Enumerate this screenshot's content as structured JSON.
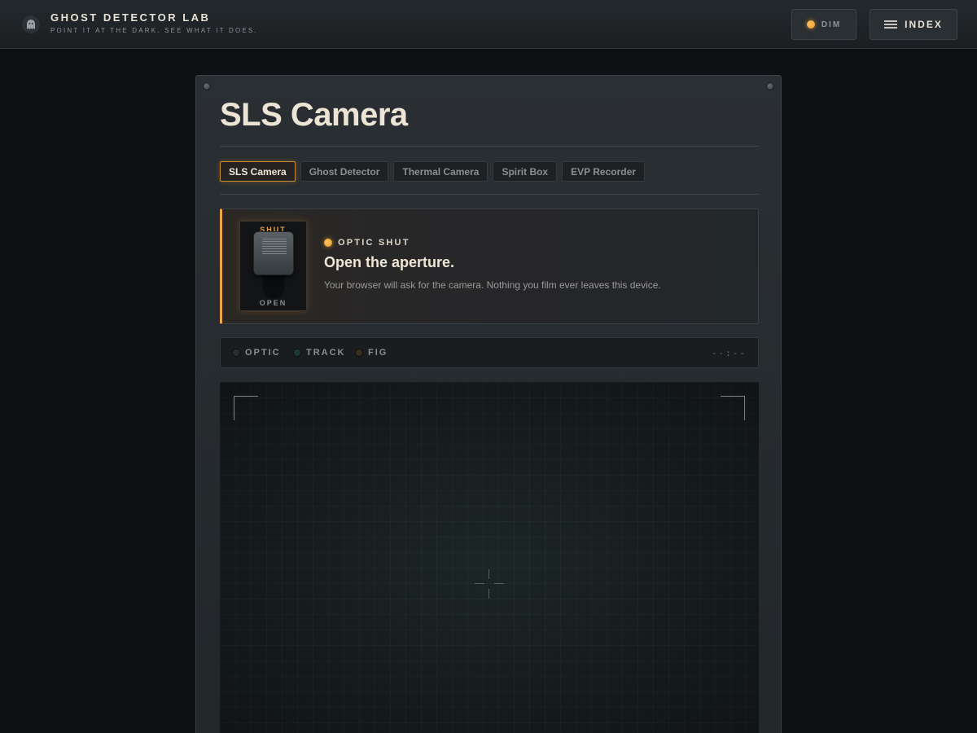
{
  "app": {
    "title": "GHOST DETECTOR LAB",
    "subtitle": "POINT IT AT THE DARK. SEE WHAT IT DOES.",
    "brand_icon": "ghost-icon"
  },
  "header": {
    "dim_label": "DIM",
    "index_label": "INDEX",
    "dim_icon": "led-indicator-icon",
    "index_icon": "hamburger-menu-icon"
  },
  "page": {
    "title": "SLS Camera"
  },
  "tabs": [
    {
      "label": "SLS Camera",
      "active": true
    },
    {
      "label": "Ghost Detector",
      "active": false
    },
    {
      "label": "Thermal Camera",
      "active": false
    },
    {
      "label": "Spirit Box",
      "active": false
    },
    {
      "label": "EVP Recorder",
      "active": false
    }
  ],
  "optic": {
    "switch_top_label": "SHUT",
    "switch_bottom_label": "OPEN",
    "status_label": "OPTIC SHUT",
    "heading": "Open the aperture.",
    "description": "Your browser will ask for the camera. Nothing you film ever leaves this device."
  },
  "indicators": [
    {
      "label": "OPTIC",
      "color": "#2a2e31"
    },
    {
      "label": "TRACK",
      "color": "#1e3a38"
    },
    {
      "label": "FIG",
      "color": "#3a2e1e"
    }
  ],
  "timecode": "--:--",
  "colors": {
    "accent": "#f0a542",
    "background": "#0e1113",
    "panel": "#2a2f33"
  }
}
